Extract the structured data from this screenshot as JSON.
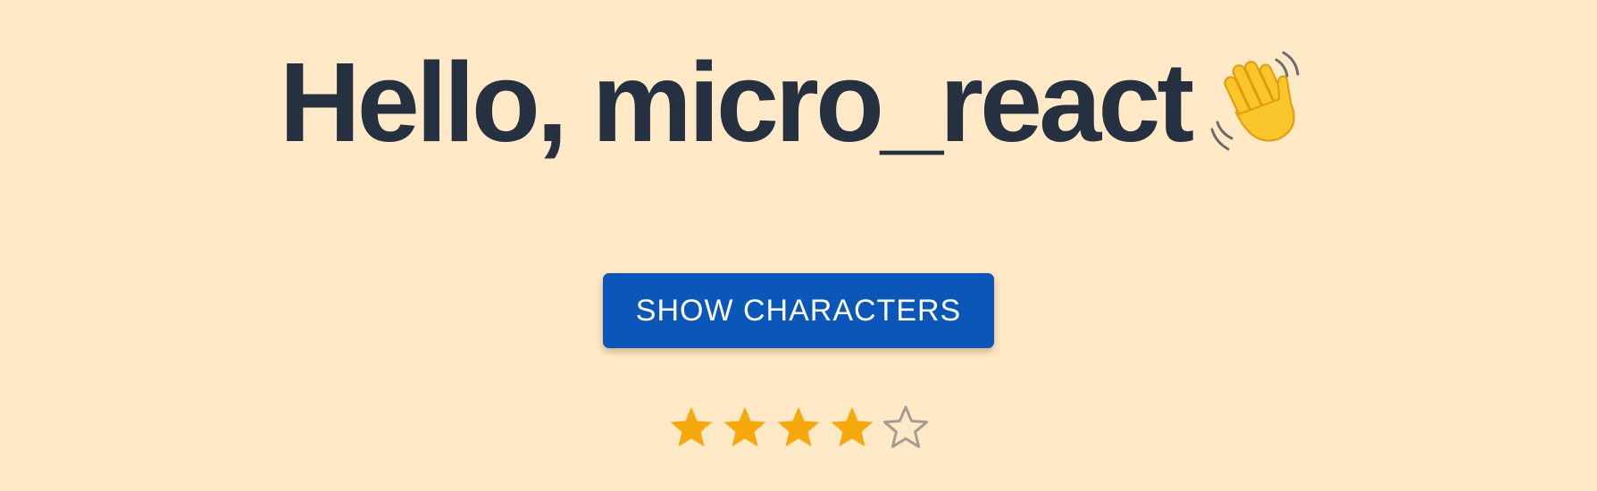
{
  "header": {
    "title": "Hello, micro_react",
    "emoji_icon": "waving-hand-icon"
  },
  "actions": {
    "show_characters_label": "SHOW CHARACTERS"
  },
  "rating": {
    "value": 4,
    "max": 5,
    "filled_color": "#f7a90c",
    "empty_color": "#a59c92"
  },
  "colors": {
    "background": "#ffe9c6",
    "title": "#253041",
    "button": "#0b56b9",
    "button_text": "#ffffff"
  }
}
